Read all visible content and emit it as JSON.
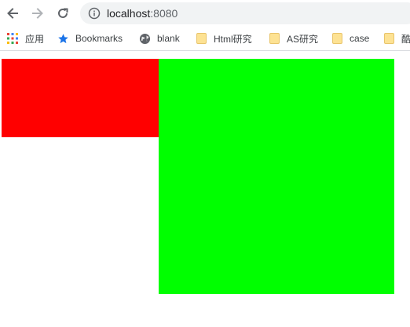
{
  "toolbar": {
    "back_icon": "arrow-left-icon",
    "forward_icon": "arrow-right-icon",
    "reload_icon": "reload-icon",
    "url_host": "localhost",
    "url_port": ":8080"
  },
  "bookmarks": {
    "items": [
      {
        "label": "应用",
        "icon": "apps-grid-icon"
      },
      {
        "label": "Bookmarks",
        "icon": "star-icon"
      },
      {
        "label": "blank",
        "icon": "globe-icon"
      },
      {
        "label": "Html研究",
        "icon": "folder-icon"
      },
      {
        "label": "AS研究",
        "icon": "folder-icon"
      },
      {
        "label": "case",
        "icon": "folder-icon"
      },
      {
        "label": "酷",
        "icon": "folder-icon"
      }
    ]
  },
  "content": {
    "red_color": "#ff0000",
    "green_color": "#00ff00"
  }
}
